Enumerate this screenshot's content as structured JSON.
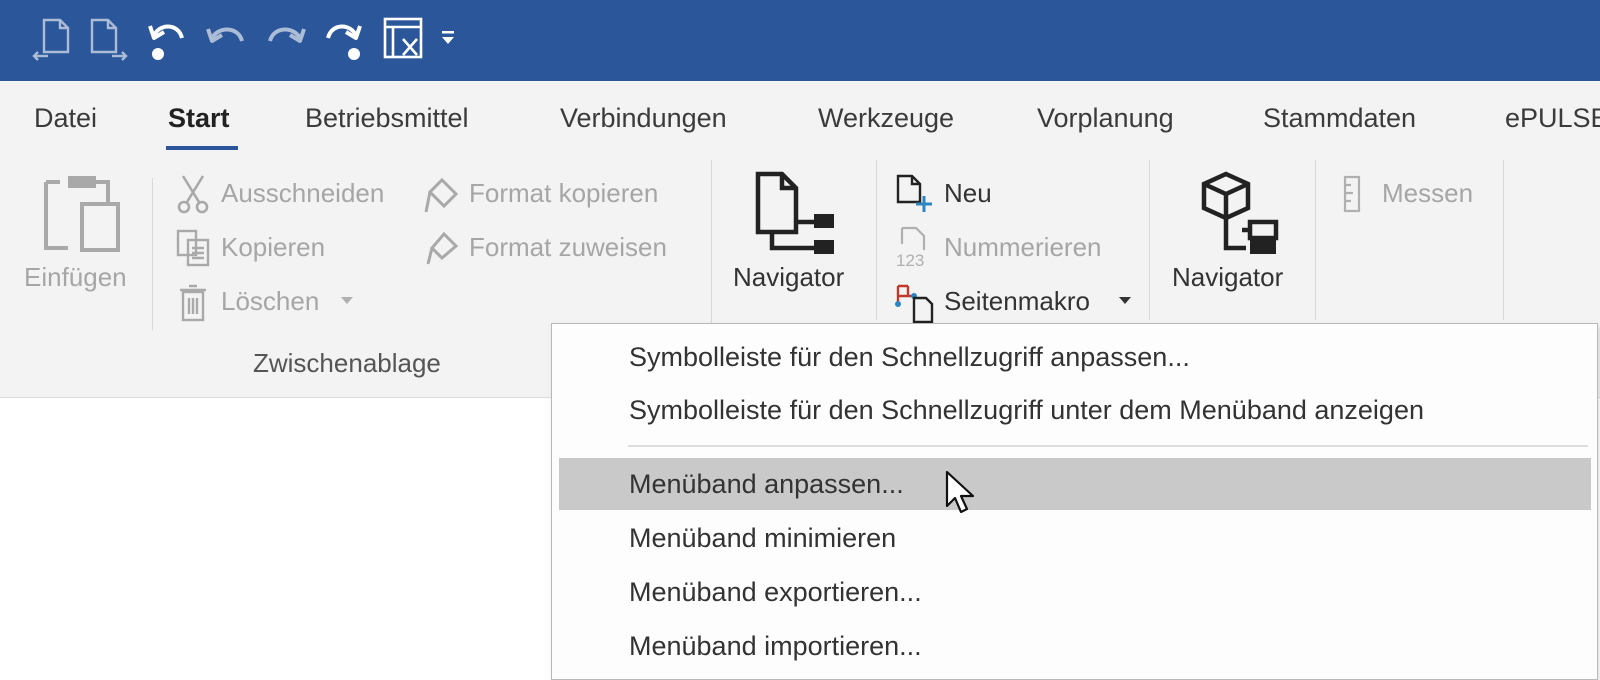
{
  "quick_access": {
    "buttons": [
      {
        "name": "page-back-icon",
        "disabled": true
      },
      {
        "name": "page-forward-icon",
        "disabled": true
      },
      {
        "name": "undo-dot-icon",
        "disabled": false
      },
      {
        "name": "undo-icon",
        "disabled": true
      },
      {
        "name": "redo-icon",
        "disabled": true
      },
      {
        "name": "redo-dot-icon",
        "disabled": false
      },
      {
        "name": "table-clear-icon",
        "disabled": false
      },
      {
        "name": "customize-dropdown-icon",
        "disabled": false
      }
    ]
  },
  "tabs": [
    {
      "label": "Datei"
    },
    {
      "label": "Start",
      "active": true
    },
    {
      "label": "Betriebsmittel"
    },
    {
      "label": "Verbindungen"
    },
    {
      "label": "Werkzeuge"
    },
    {
      "label": "Vorplanung"
    },
    {
      "label": "Stammdaten"
    },
    {
      "label": "ePULSE"
    }
  ],
  "ribbon": {
    "clipboard": {
      "paste_label": "Einfügen",
      "cut_label": "Ausschneiden",
      "copy_label": "Kopieren",
      "delete_label": "Löschen",
      "format_copy_label": "Format kopieren",
      "format_assign_label": "Format zuweisen",
      "group_label": "Zwischenablage"
    },
    "navigator1_label": "Navigator",
    "page": {
      "new_label": "Neu",
      "number_label": "Nummerieren",
      "page_macro_label": "Seitenmakro"
    },
    "navigator2_label": "Navigator",
    "measure_label": "Messen"
  },
  "context_menu": {
    "items": [
      {
        "label": "Symbolleiste für den Schnellzugriff anpassen..."
      },
      {
        "label": "Symbolleiste für den Schnellzugriff unter dem Menüband anzeigen"
      },
      {
        "label": "Menüband anpassen...",
        "hovered": true
      },
      {
        "label": "Menüband minimieren"
      },
      {
        "label": "Menüband exportieren..."
      },
      {
        "label": "Menüband importieren..."
      }
    ]
  },
  "colors": {
    "titlebar": "#2b579a",
    "ribbon_bg": "#f3f3f3",
    "active_tab_underline": "#2b579a",
    "menu_hover": "#c9c9c9"
  }
}
